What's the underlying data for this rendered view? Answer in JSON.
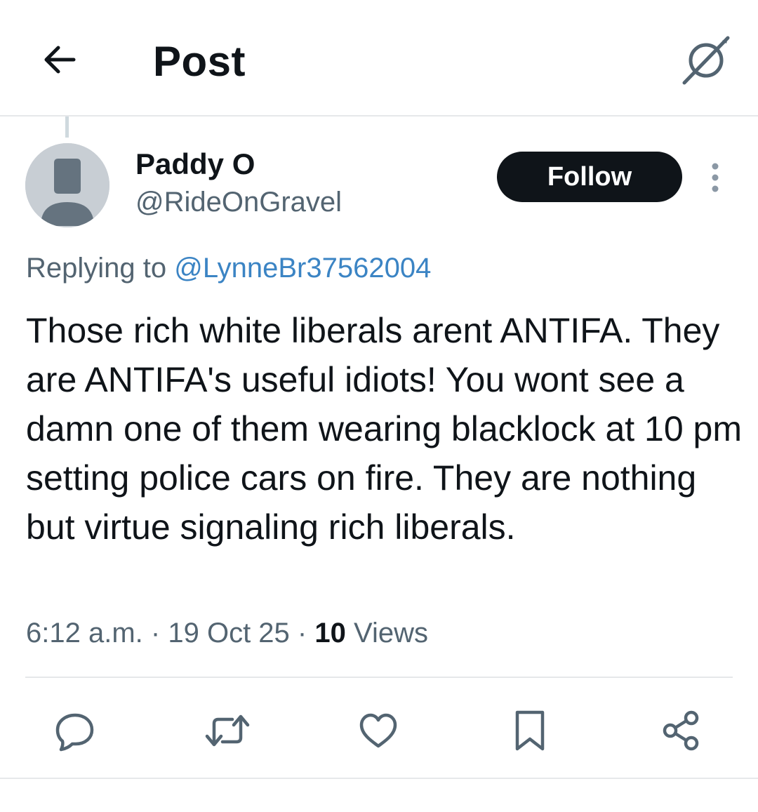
{
  "header": {
    "title": "Post",
    "back_icon": "arrow-left-icon",
    "grok_icon": "grok-icon"
  },
  "post": {
    "author_name": "Paddy O",
    "author_handle": "@RideOnGravel",
    "avatar_icon": "default-avatar-icon",
    "follow_label": "Follow",
    "more_icon": "more-vertical-icon",
    "replying_prefix": "Replying to",
    "replying_mention": "@LynneBr37562004",
    "text": "Those rich white liberals arent ANTIFA. They are ANTIFA's useful idiots! You wont see a damn one of them wearing blacklock at 10 pm setting police cars on fire. They are nothing but virtue signaling rich liberals.",
    "time": "6:12 a.m.",
    "date": "19 Oct 25",
    "views_count": "10",
    "views_label": "Views",
    "separator": "·"
  },
  "actions": [
    {
      "icon": "reply-icon"
    },
    {
      "icon": "repost-icon"
    },
    {
      "icon": "like-icon"
    },
    {
      "icon": "bookmark-icon"
    },
    {
      "icon": "share-icon"
    }
  ],
  "colors": {
    "text_primary": "#0f1419",
    "text_secondary": "#536471",
    "mention": "#3b84c4",
    "button_bg": "#0f1419",
    "divider": "#e6e8ea"
  }
}
